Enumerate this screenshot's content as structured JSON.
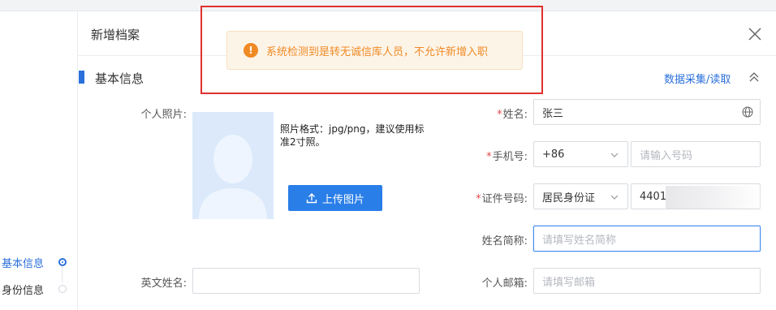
{
  "dialog": {
    "title": "新增档案"
  },
  "section": {
    "title": "基本信息",
    "collect_link": "数据采集/读取"
  },
  "toast": {
    "message": "系统检测到是转无诚信库人员，不允许新增入职",
    "icon": "exclamation-icon",
    "color": "#f08a24"
  },
  "steps": [
    {
      "label": "基本信息",
      "active": true
    },
    {
      "label": "身份信息",
      "active": false
    }
  ],
  "form": {
    "photo_label": "个人照片:",
    "photo_tip": "照片格式：jpg/png，建议使用标准2寸照。",
    "upload_button": "上传图片",
    "name_label": "姓名:",
    "name_value": "张三",
    "phone_label": "手机号:",
    "phone_prefix": "+86",
    "phone_placeholder": "请输入号码",
    "id_label": "证件号码:",
    "id_type": "居民身份证",
    "id_value": "4401",
    "short_name_label": "姓名简称:",
    "short_name_placeholder": "请填写姓名简称",
    "english_name_label": "英文姓名:",
    "email_label": "个人邮箱:",
    "email_placeholder": "请填写邮箱",
    "required_mark": "*"
  },
  "colors": {
    "accent": "#2a6fdb",
    "button": "#2a7ee8",
    "warning": "#f08a24",
    "highlight_border": "#e0302f"
  }
}
